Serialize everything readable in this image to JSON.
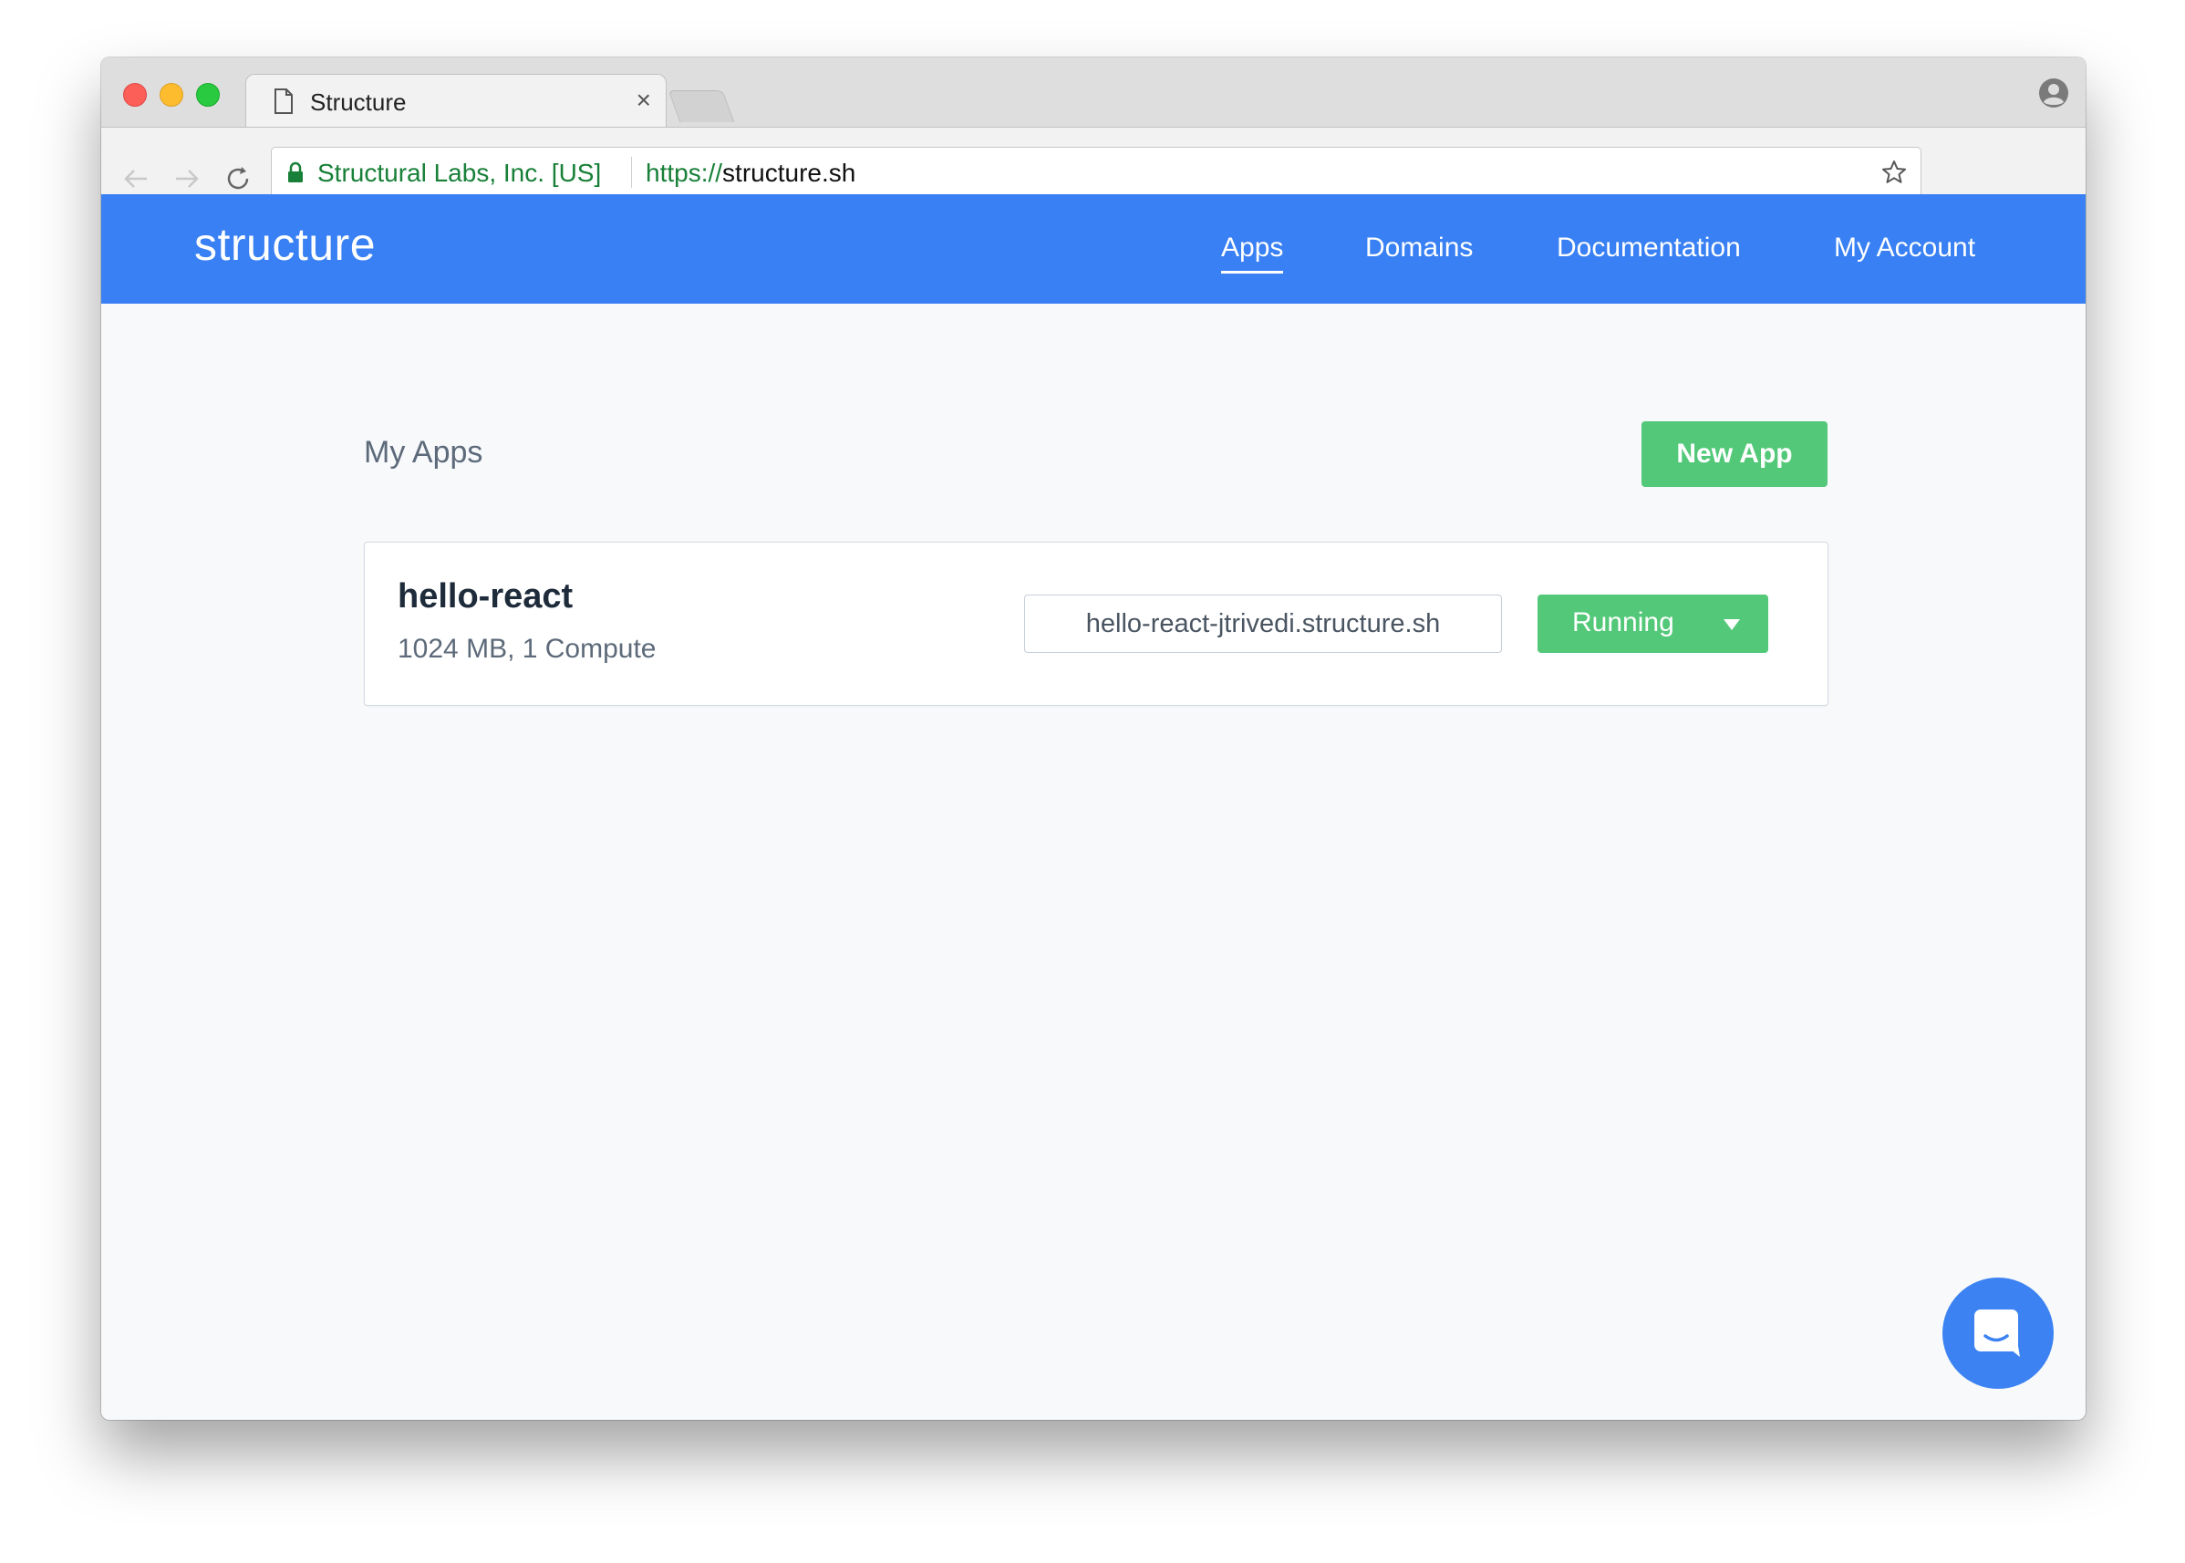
{
  "browser": {
    "tab_title": "Structure",
    "secure_name": "Structural Labs, Inc. [US]",
    "url_protocol": "https://",
    "url_host": "structure.sh"
  },
  "site": {
    "brand": "structure",
    "nav": {
      "apps": "Apps",
      "domains": "Domains",
      "documentation": "Documentation",
      "account": "My Account"
    },
    "active_nav": "Apps"
  },
  "main": {
    "title": "My Apps",
    "new_app_label": "New App",
    "apps": [
      {
        "name": "hello-react",
        "meta": "1024 MB, 1 Compute",
        "url": "hello-react-jtrivedi.structure.sh",
        "status": "Running"
      }
    ]
  },
  "colors": {
    "header": "#3880f3",
    "success": "#52c878",
    "chat": "#3c82f2"
  },
  "icons": {
    "chat": "chat-icon",
    "status_menu": "caret-down-icon"
  }
}
